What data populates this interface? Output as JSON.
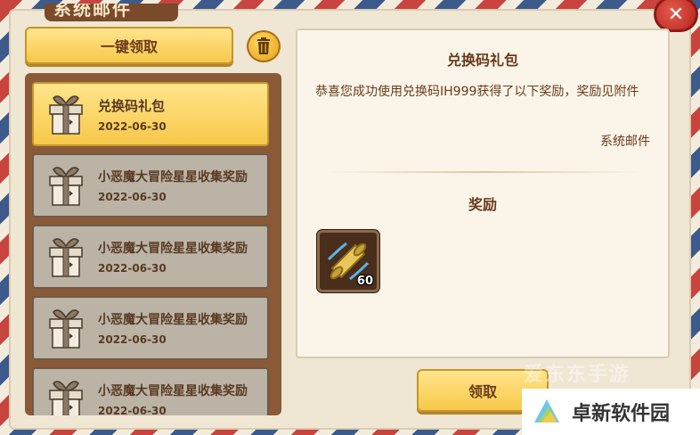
{
  "header": {
    "title": "系统邮件"
  },
  "actions": {
    "one_click_claim": "一键领取",
    "claim": "领取"
  },
  "mail_list": [
    {
      "title": "兑换码礼包",
      "date": "2022-06-30",
      "selected": true
    },
    {
      "title": "小恶魔大冒险星星收集奖励",
      "date": "2022-06-30",
      "selected": false
    },
    {
      "title": "小恶魔大冒险星星收集奖励",
      "date": "2022-06-30",
      "selected": false
    },
    {
      "title": "小恶魔大冒险星星收集奖励",
      "date": "2022-06-30",
      "selected": false
    },
    {
      "title": "小恶魔大冒险星星收集奖励",
      "date": "2022-06-30",
      "selected": false
    }
  ],
  "detail": {
    "title": "兑换码礼包",
    "body": "恭喜您成功使用兑换码IH999获得了以下奖励，奖励见附件",
    "sender": "系统邮件",
    "reward_heading": "奖励",
    "rewards": [
      {
        "icon": "scroll-icon",
        "count": "60"
      }
    ]
  },
  "watermark": {
    "faint": "爱东东手游",
    "site": "卓新软件园"
  },
  "colors": {
    "accent": "#f7c84a",
    "text": "#6a3a1a",
    "list_bg": "#8a5a38"
  }
}
